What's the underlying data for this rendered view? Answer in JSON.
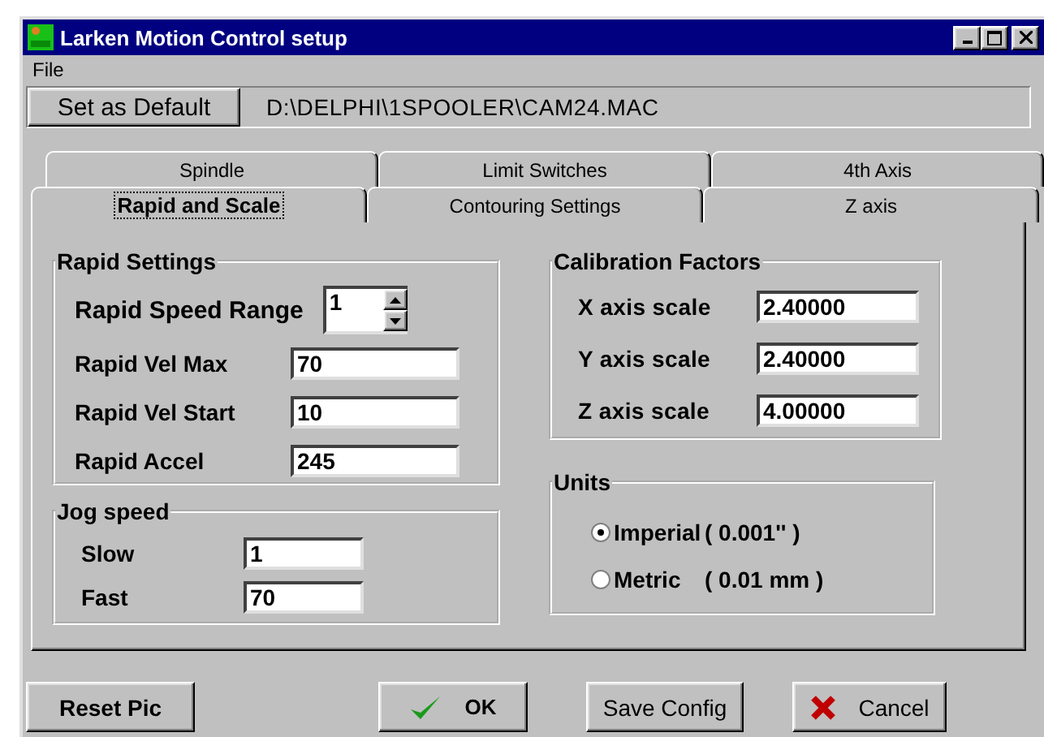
{
  "window": {
    "title": "Larken Motion Control setup"
  },
  "menu": [
    "File"
  ],
  "default_button": "Set as Default",
  "config_path": "D:\\DELPHI\\1SPOOLER\\CAM24.MAC",
  "tab_rows": [
    [
      {
        "label": "Spindle",
        "selected": false
      },
      {
        "label": "Limit Switches",
        "selected": false
      },
      {
        "label": "4th Axis",
        "selected": false
      }
    ],
    [
      {
        "label": "Rapid and Scale",
        "selected": true
      },
      {
        "label": "Contouring Settings",
        "selected": false
      },
      {
        "label": "Z axis",
        "selected": false
      }
    ]
  ],
  "rapid_settings": {
    "title": "Rapid Settings",
    "speed_range": {
      "label": "Rapid Speed Range",
      "value": "1"
    },
    "fields": [
      {
        "label": "Rapid Vel Max",
        "value": "70"
      },
      {
        "label": "Rapid Vel Start",
        "value": "10"
      },
      {
        "label": "Rapid Accel",
        "value": "245"
      }
    ]
  },
  "jog_speed": {
    "title": "Jog speed",
    "fields": [
      {
        "label": "Slow",
        "value": "1"
      },
      {
        "label": "Fast",
        "value": "70"
      }
    ]
  },
  "calibration": {
    "title": "Calibration Factors",
    "fields": [
      {
        "label": "X axis scale",
        "value": "2.40000"
      },
      {
        "label": "Y axis scale",
        "value": "2.40000"
      },
      {
        "label": "Z axis scale",
        "value": "4.00000"
      }
    ]
  },
  "units": {
    "title": "Units",
    "options": [
      {
        "label": "Imperial",
        "detail": "( 0.001'' )",
        "selected": true
      },
      {
        "label": "Metric",
        "detail": "( 0.01 mm )",
        "selected": false
      }
    ]
  },
  "buttons": [
    {
      "label": "Reset Pic",
      "kind": "reset"
    },
    {
      "label": "OK",
      "kind": "ok"
    },
    {
      "label": "Save Config",
      "kind": "save"
    },
    {
      "label": "Cancel",
      "kind": "cancel"
    }
  ]
}
